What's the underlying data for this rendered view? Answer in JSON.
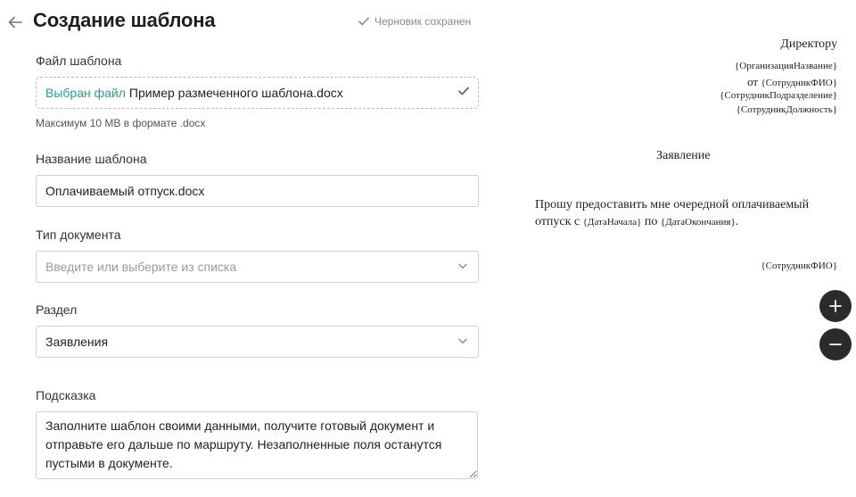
{
  "header": {
    "title": "Создание шаблона",
    "draft_status": "Черновик сохранен",
    "back_icon": "arrow-left-icon",
    "status_icon": "check-icon"
  },
  "form": {
    "file": {
      "label": "Файл шаблона",
      "link_text": "Выбран файл",
      "file_name": "Пример размеченного шаблона.docx",
      "limit_hint": "Максимум 10 MB в формате .docx"
    },
    "name": {
      "label": "Название шаблона",
      "value": "Оплачиваемый отпуск.docx"
    },
    "doc_type": {
      "label": "Тип документа",
      "placeholder": "Введите или выберите из списка"
    },
    "section": {
      "label": "Раздел",
      "value": "Заявления"
    },
    "hint": {
      "label": "Подсказка",
      "value": "Заполните шаблон своими данными, получите готовый документ и отправьте его дальше по маршруту. Незаполненные поля останутся пустыми в документе."
    }
  },
  "preview": {
    "to_title": "Директору",
    "org_name": "{ОрганизацияНазвание}",
    "from_prefix": "от",
    "employee_name": "{СотрудникФИО}",
    "employee_department": "{СотрудникПодразделение}",
    "employee_position": "{СотрудникДолжность}",
    "doc_title": "Заявление",
    "body_text_1": "Прошу предоставить мне очередной оплачиваемый отпуск с",
    "start_var": "{ДатаНачала}",
    "body_text_2": "по",
    "end_var": "{ДатаОкончания}",
    "body_text_3": ".",
    "signature_var": "{СотрудникФИО}"
  },
  "zoom": {
    "in_icon": "plus-icon",
    "out_icon": "minus-icon"
  },
  "colors": {
    "accent": "#2e9e8c",
    "zoom_button": "#2b2b2b"
  }
}
